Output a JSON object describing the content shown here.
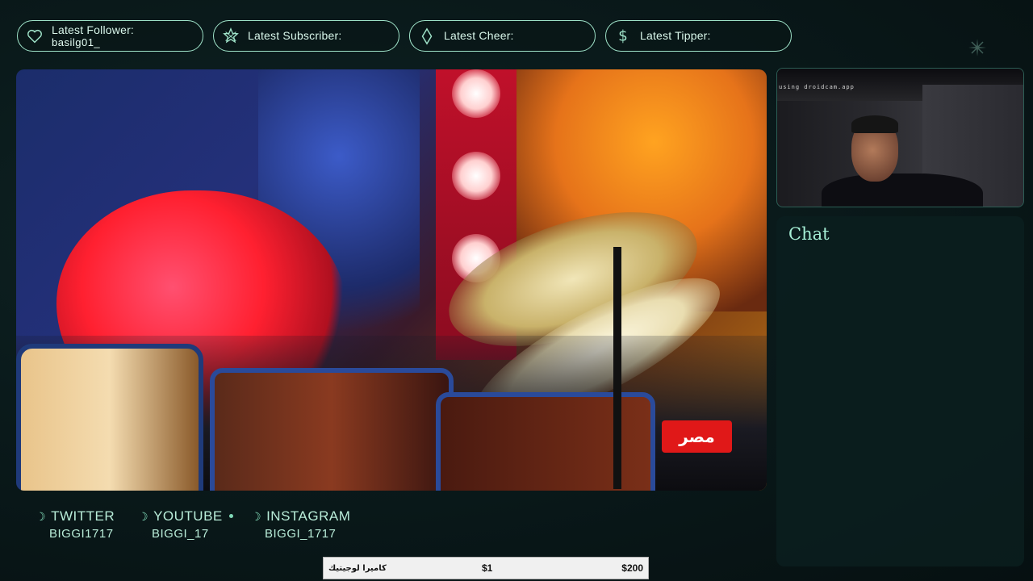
{
  "alerts": [
    {
      "label": "Latest Follower:",
      "value": "basilg01_",
      "icon": "heart-icon"
    },
    {
      "label": "Latest Subscriber:",
      "value": "",
      "icon": "star-icon"
    },
    {
      "label": "Latest Cheer:",
      "value": "",
      "icon": "diamond-icon"
    },
    {
      "label": "Latest Tipper:",
      "value": "",
      "icon": "dollar-icon"
    }
  ],
  "video": {
    "channel_badge": "مصر"
  },
  "webcam": {
    "watermark": "using droidcam.app"
  },
  "chat": {
    "title": "Chat"
  },
  "socials": [
    {
      "name": "TWITTER",
      "handle": "BIGGI1717"
    },
    {
      "name": "YOUTUBE",
      "handle": "BIGGI_17"
    },
    {
      "name": "INSTAGRAM",
      "handle": "BIGGI_1717"
    }
  ],
  "ticker": {
    "product": "كاميرا لوجيتيك",
    "price_low": "$1",
    "price_high": "$200"
  },
  "colors": {
    "accent": "#9fe3c9",
    "background": "#0a1a1b",
    "badge_red": "#e01818"
  }
}
